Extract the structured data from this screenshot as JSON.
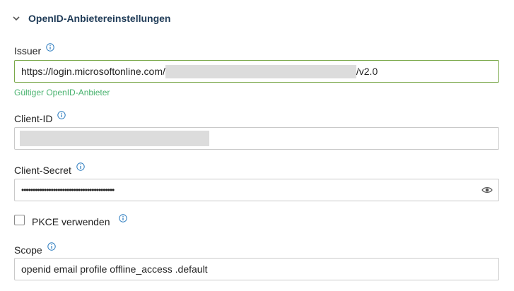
{
  "section": {
    "title": "OpenID-Anbietereinstellungen",
    "expanded": true
  },
  "issuer": {
    "label": "Issuer",
    "value_prefix": "https://login.microsoftonline.com/",
    "value_suffix": "/v2.0",
    "validation": "Gültiger OpenID-Anbieter"
  },
  "client_id": {
    "label": "Client-ID"
  },
  "client_secret": {
    "label": "Client-Secret",
    "masked_value": "•••••••••••••••••••••••••••••••••••••••••"
  },
  "pkce": {
    "label": "PKCE verwenden",
    "checked": false
  },
  "scope": {
    "label": "Scope",
    "value": "openid email profile offline_access .default"
  },
  "colors": {
    "accent": "#1f3b57",
    "valid": "#48b26e",
    "info": "#2b7bbf",
    "valid_border": "#7aa84a"
  }
}
